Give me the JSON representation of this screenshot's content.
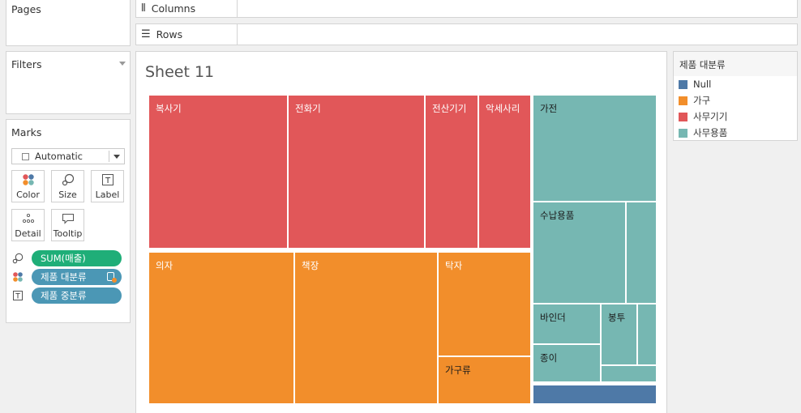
{
  "pages": {
    "title": "Pages"
  },
  "shelves": {
    "columns": {
      "label": "Columns",
      "icon": "columns-icon"
    },
    "rows": {
      "label": "Rows",
      "icon": "rows-icon"
    }
  },
  "filters": {
    "title": "Filters"
  },
  "marks": {
    "title": "Marks",
    "type": "Automatic",
    "buttons": {
      "color": "Color",
      "size": "Size",
      "label": "Label",
      "detail": "Detail",
      "tooltip": "Tooltip"
    },
    "pills": [
      {
        "text": "SUM(매출)",
        "icon": "size-icon",
        "color": "#1fae78"
      },
      {
        "text": "제품 대분류",
        "icon": "color-icon",
        "color": "#4b97b5"
      },
      {
        "text": "제품 중분류",
        "icon": "label-icon",
        "color": "#4b97b5"
      }
    ]
  },
  "sheet": {
    "title": "Sheet 11",
    "tiles": [
      {
        "label": "복사기",
        "category": "사무기기",
        "dark_text": false
      },
      {
        "label": "전화기",
        "category": "사무기기",
        "dark_text": false
      },
      {
        "label": "전산기기",
        "category": "사무기기",
        "dark_text": false
      },
      {
        "label": "악세사리",
        "category": "사무기기",
        "dark_text": false
      },
      {
        "label": "의자",
        "category": "가구",
        "dark_text": false
      },
      {
        "label": "책장",
        "category": "가구",
        "dark_text": false
      },
      {
        "label": "탁자",
        "category": "가구",
        "dark_text": false
      },
      {
        "label": "가구류",
        "category": "가구",
        "dark_text": true
      },
      {
        "label": "가전",
        "category": "사무용품",
        "dark_text": true
      },
      {
        "label": "수납용품",
        "category": "사무용품",
        "dark_text": true
      },
      {
        "label": "",
        "category": "사무용품",
        "dark_text": true
      },
      {
        "label": "바인더",
        "category": "사무용품",
        "dark_text": true
      },
      {
        "label": "봉투",
        "category": "사무용품",
        "dark_text": true
      },
      {
        "label": "",
        "category": "사무용품",
        "dark_text": true
      },
      {
        "label": "종이",
        "category": "사무용품",
        "dark_text": true
      },
      {
        "label": "",
        "category": "사무용품",
        "dark_text": true
      },
      {
        "label": "",
        "category": "Null",
        "dark_text": false
      }
    ]
  },
  "legend": {
    "title": "제품 대분류",
    "items": [
      {
        "label": "Null",
        "color": "#4e79a7"
      },
      {
        "label": "가구",
        "color": "#f28e2b"
      },
      {
        "label": "사무기기",
        "color": "#e15759"
      },
      {
        "label": "사무용품",
        "color": "#76b7b2"
      }
    ]
  },
  "colors": {
    "Null": "#4e79a7",
    "가구": "#f28e2b",
    "사무기기": "#e15759",
    "사무용품": "#76b7b2"
  }
}
